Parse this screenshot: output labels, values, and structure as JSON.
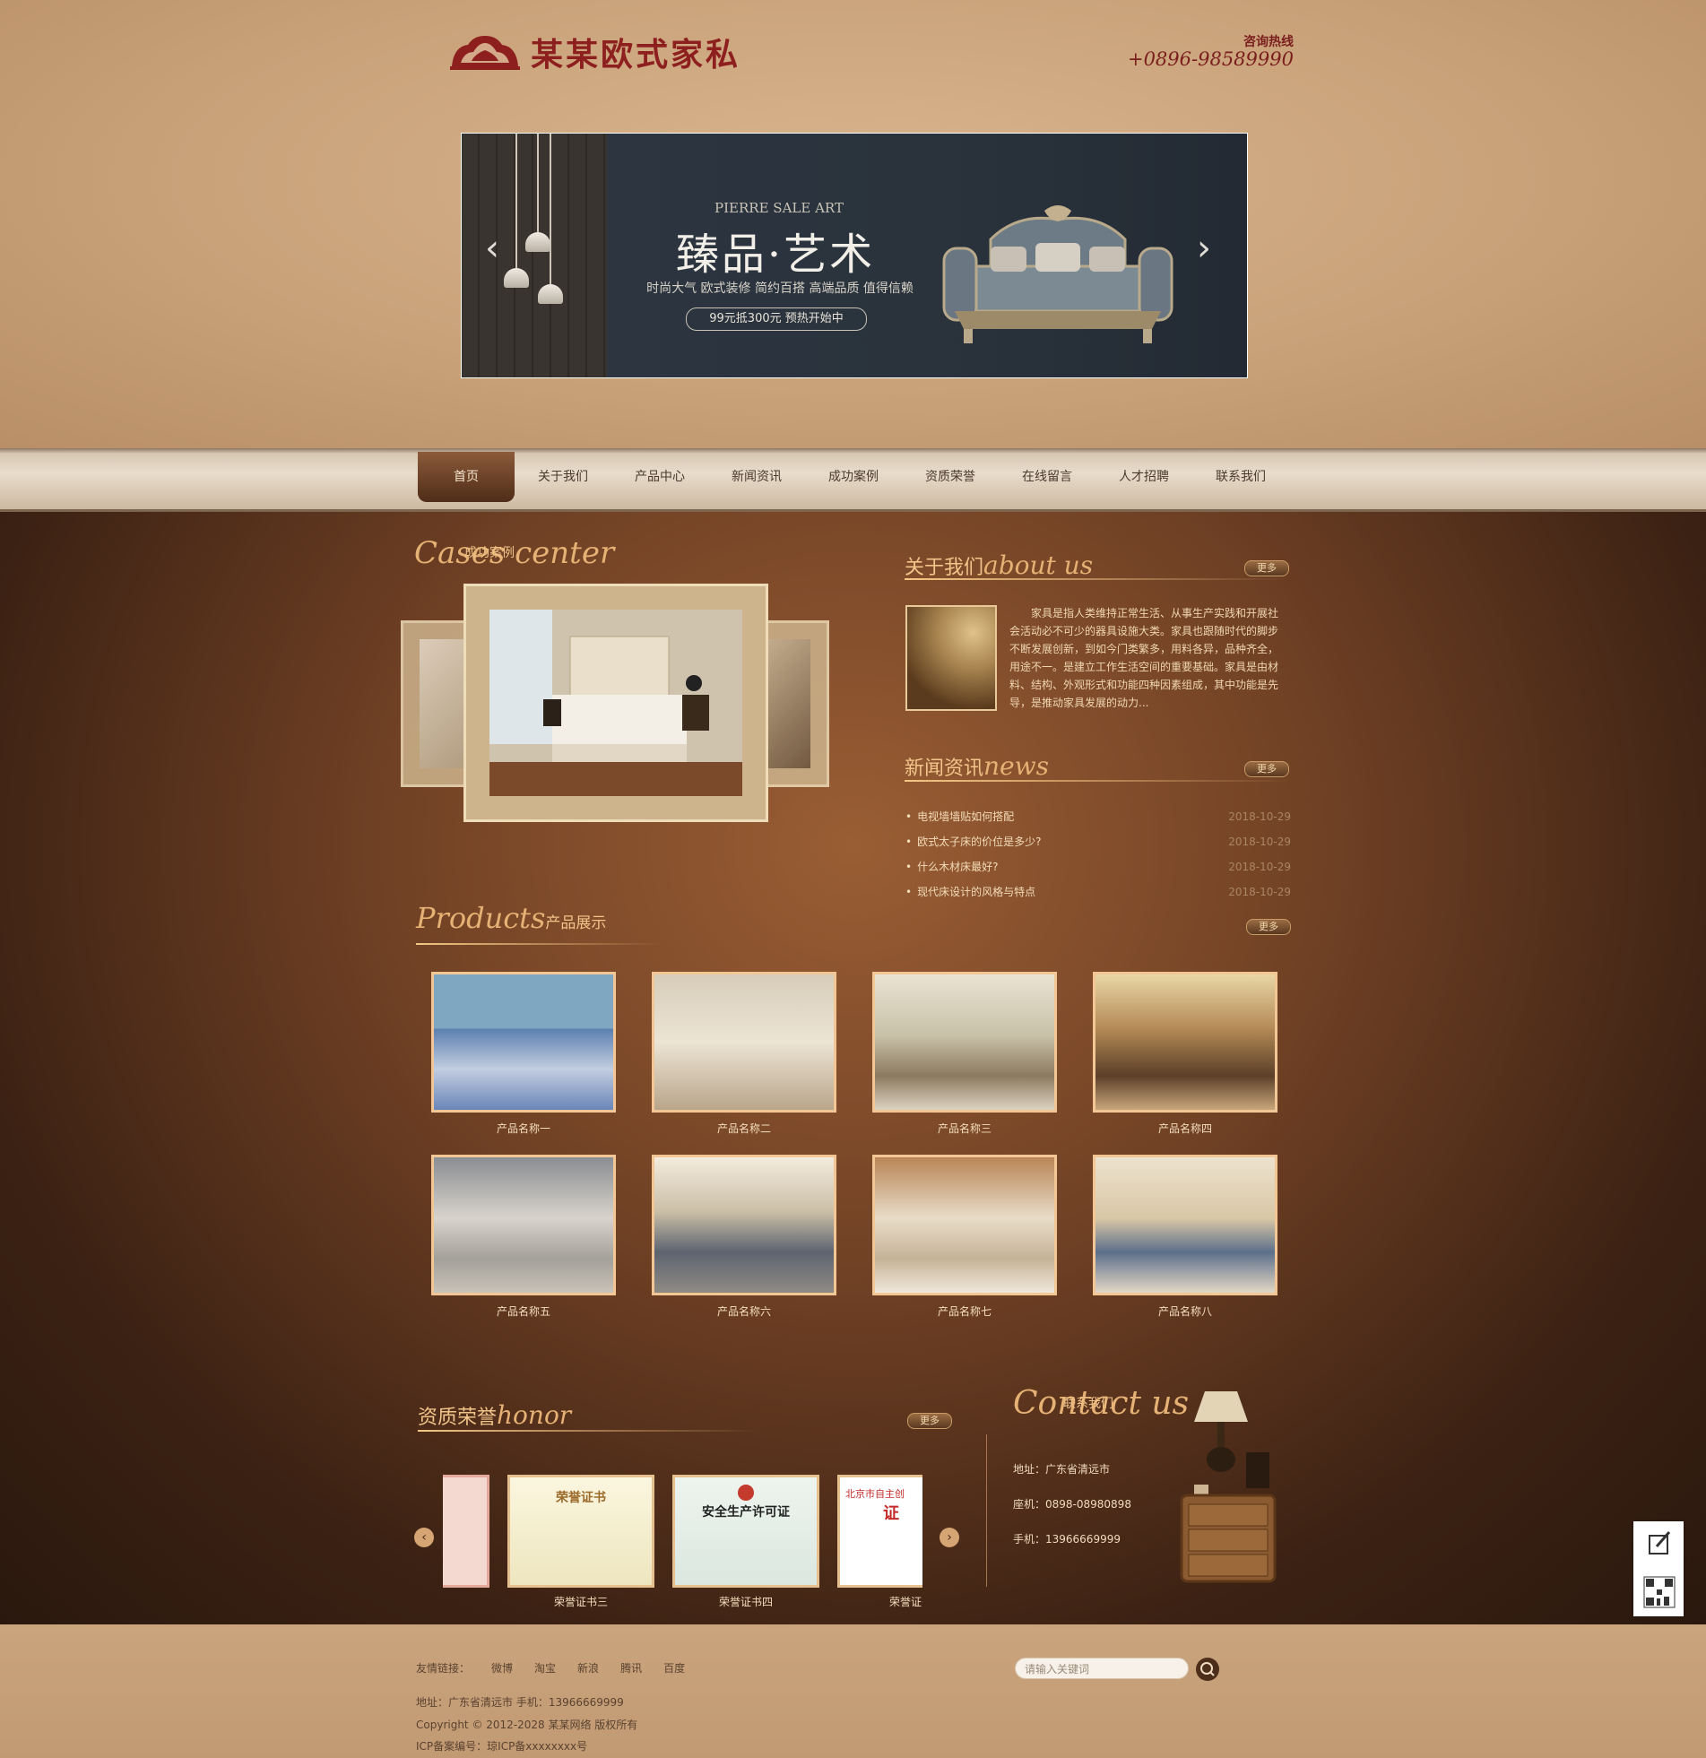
{
  "header": {
    "brand": "某某欧式家私",
    "hotline_label": "咨询热线",
    "hotline_number": "+0896-98589990"
  },
  "banner": {
    "english": "PIERRE SALE ART",
    "title": "臻品·艺术",
    "subtitle": "时尚大气 欧式装修  简约百搭 高端品质 值得信赖",
    "badge": "99元抵300元  预热开始中",
    "prev_icon": "chevron-left-icon",
    "next_icon": "chevron-right-icon"
  },
  "nav": {
    "items": [
      "首页",
      "关于我们",
      "产品中心",
      "新闻资讯",
      "成功案例",
      "资质荣誉",
      "在线留言",
      "人才招聘",
      "联系我们"
    ]
  },
  "cases": {
    "title_cn": "成功案例",
    "title_en": "Cases center"
  },
  "about": {
    "title_cn": "关于我们",
    "title_en": "about us",
    "more": "更多",
    "text": "家具是指人类维持正常生活、从事生产实践和开展社会活动必不可少的器具设施大类。家具也跟随时代的脚步不断发展创新，到如今门类繁多，用料各异，品种齐全，用途不一。是建立工作生活空间的重要基础。家具是由材料、结构、外观形式和功能四种因素组成，其中功能是先导，是推动家具发展的动力..."
  },
  "news": {
    "title_cn": "新闻资讯",
    "title_en": "news",
    "more": "更多",
    "items": [
      {
        "title": "电视墙墙贴如何搭配",
        "date": "2018-10-29"
      },
      {
        "title": "欧式太子床的价位是多少?",
        "date": "2018-10-29"
      },
      {
        "title": "什么木材床最好?",
        "date": "2018-10-29"
      },
      {
        "title": "现代床设计的风格与特点",
        "date": "2018-10-29"
      }
    ]
  },
  "products": {
    "title_en": "Products",
    "title_cn": "产品展示",
    "more": "更多",
    "items": [
      "产品名称一",
      "产品名称二",
      "产品名称三",
      "产品名称四",
      "产品名称五",
      "产品名称六",
      "产品名称七",
      "产品名称八"
    ]
  },
  "honor": {
    "title_cn": "资质荣誉",
    "title_en": "honor",
    "more": "更多",
    "cert1_heading": "荣誉证书",
    "cert2_heading": "安全生产许可证",
    "cert3_heading": "北京市自主创",
    "cert3_big": "证",
    "items": [
      "荣誉证书三",
      "荣誉证书四",
      "荣誉证书"
    ]
  },
  "contact": {
    "title_cn": "联系我们",
    "title_en": "Contact us",
    "address": "地址：广东省清远市",
    "landline": "座机：0898-08980898",
    "mobile": "手机：13966669999"
  },
  "footer": {
    "links_label": "友情链接：",
    "links": [
      "微博",
      "淘宝",
      "新浪",
      "腾讯",
      "百度"
    ],
    "search_placeholder": "请输入关键词",
    "address_line": "地址：广东省清远市     手机：13966669999",
    "copyright": "Copyright © 2012-2028 某某网络 版权所有",
    "icp": "ICP备案编号：琼ICP备xxxxxxxx号"
  },
  "colors": {
    "brand": "#8e1f1f",
    "gold": "#f1c48a",
    "nav_active": "#6a3d22"
  }
}
